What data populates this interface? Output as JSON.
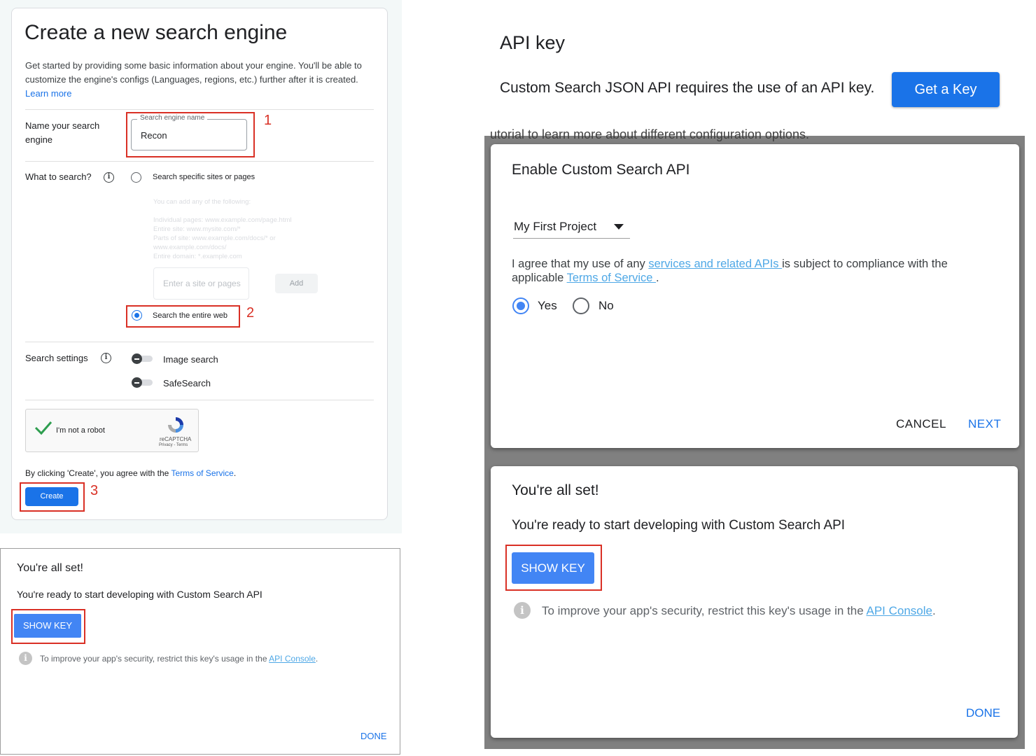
{
  "create_engine": {
    "title": "Create a new search engine",
    "description": "Get started by providing some basic information about your engine. You'll be able to customize the engine's configs (Languages, regions, etc.) further after it is created.",
    "learn_more": "Learn more",
    "name_label": "Name your search engine",
    "name_field_legend": "Search engine name",
    "name_field_value": "Recon",
    "what_label": "What to search?",
    "option_specific": "Search specific sites or pages",
    "add_hint": "You can add any of the following:",
    "examples": [
      "Individual pages: www.example.com/page.html",
      "Entire site: www.mysite.com/*",
      "Parts of site: www.example.com/docs/* or www.example.com/docs/",
      "Entire domain: *.example.com"
    ],
    "site_placeholder": "Enter a site or pages",
    "add_button": "Add",
    "option_entire_web": "Search the entire web",
    "settings_label": "Search settings",
    "image_search": "Image search",
    "safesearch": "SafeSearch",
    "captcha_text": "I'm not a robot",
    "captcha_brand": "reCAPTCHA",
    "captcha_links": "Privacy - Terms",
    "terms_prefix": "By clicking 'Create', you agree with the ",
    "terms_link": "Terms of Service",
    "terms_suffix": ".",
    "create_button": "Create",
    "step_labels": [
      "1",
      "2",
      "3"
    ]
  },
  "small_dialog": {
    "title": "You're all set!",
    "subtitle": "You're ready to start developing with Custom Search API",
    "show_key": "SHOW KEY",
    "info_glyph": "i",
    "note_prefix": "To improve your app's security, restrict this key's usage in the ",
    "note_link": "API Console",
    "note_suffix": ".",
    "done": "DONE"
  },
  "api_key": {
    "title": "API key",
    "text": "Custom Search JSON API requires the use of an API key.",
    "get_key_button": "Get a Key",
    "bleed_text": "utorial to learn more about different configuration options."
  },
  "enable_dialog": {
    "title": "Enable Custom Search API",
    "project": "My First Project",
    "agree_prefix": "I agree that my use of any ",
    "agree_link1": "services and related APIs ",
    "agree_middle": "is subject to compliance with the applicable ",
    "agree_link2": "Terms of Service ",
    "agree_suffix": ".",
    "yes": "Yes",
    "no": "No",
    "cancel": "CANCEL",
    "next": "NEXT"
  },
  "large_dialog": {
    "title": "You're all set!",
    "subtitle": "You're ready to start developing with Custom Search API",
    "show_key": "SHOW KEY",
    "info_glyph": "i",
    "note_prefix": "To improve your app's security, restrict this key's usage in the ",
    "note_link": "API Console",
    "note_suffix": ".",
    "done": "DONE"
  },
  "colors": {
    "accent": "#1a73e8",
    "annotation_red": "#d93025",
    "button_blue": "#4285f4"
  }
}
